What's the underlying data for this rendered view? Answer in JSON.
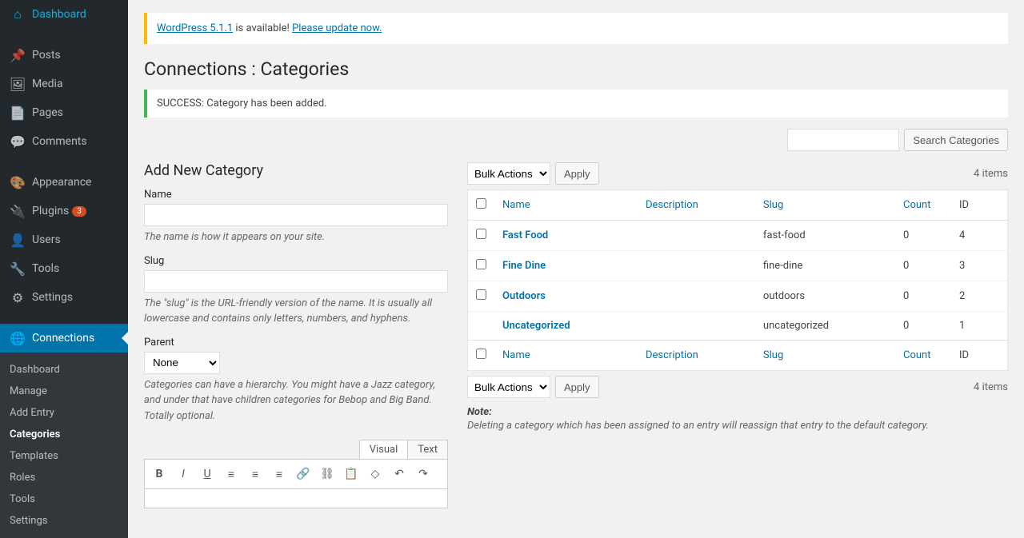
{
  "sidebar": {
    "items": [
      {
        "icon": "⌂",
        "label": "Dashboard"
      },
      {
        "sep": true
      },
      {
        "icon": "📌",
        "label": "Posts"
      },
      {
        "icon": "🖼",
        "label": "Media"
      },
      {
        "icon": "📄",
        "label": "Pages"
      },
      {
        "icon": "💬",
        "label": "Comments"
      },
      {
        "sep": true
      },
      {
        "icon": "🎨",
        "label": "Appearance"
      },
      {
        "icon": "🔌",
        "label": "Plugins",
        "badge": "3"
      },
      {
        "icon": "👤",
        "label": "Users"
      },
      {
        "icon": "🔧",
        "label": "Tools"
      },
      {
        "icon": "⚙",
        "label": "Settings"
      },
      {
        "sep": true
      },
      {
        "icon": "🌐",
        "label": "Connections",
        "current": true
      }
    ],
    "submenu": [
      "Dashboard",
      "Manage",
      "Add Entry",
      "Categories",
      "Templates",
      "Roles",
      "Tools",
      "Settings"
    ],
    "submenu_current": "Categories"
  },
  "update_nag": {
    "link1": "WordPress 5.1.1",
    "mid": " is available! ",
    "link2": "Please update now."
  },
  "page_title": "Connections : Categories",
  "success_msg": "SUCCESS: Category has been added.",
  "search_btn": "Search Categories",
  "form": {
    "heading": "Add New Category",
    "name_label": "Name",
    "name_help": "The name is how it appears on your site.",
    "slug_label": "Slug",
    "slug_help": "The \"slug\" is the URL-friendly version of the name. It is usually all lowercase and contains only letters, numbers, and hyphens.",
    "parent_label": "Parent",
    "parent_value": "None",
    "parent_help": "Categories can have a hierarchy. You might have a Jazz category, and under that have children categories for Bebop and Big Band. Totally optional.",
    "tab_visual": "Visual",
    "tab_text": "Text"
  },
  "bulk": {
    "label": "Bulk Actions",
    "apply": "Apply"
  },
  "items_count": "4 items",
  "cols": {
    "name": "Name",
    "desc": "Description",
    "slug": "Slug",
    "count": "Count",
    "id": "ID"
  },
  "rows": [
    {
      "name": "Fast Food",
      "slug": "fast-food",
      "count": "0",
      "id": "4"
    },
    {
      "name": "Fine Dine",
      "slug": "fine-dine",
      "count": "0",
      "id": "3"
    },
    {
      "name": "Outdoors",
      "slug": "outdoors",
      "count": "0",
      "id": "2"
    },
    {
      "name": "Uncategorized",
      "slug": "uncategorized",
      "count": "0",
      "id": "1",
      "nocb": true
    }
  ],
  "note": {
    "title": "Note:",
    "text": "Deleting a category which has been assigned to an entry will reassign that entry to the default category."
  }
}
